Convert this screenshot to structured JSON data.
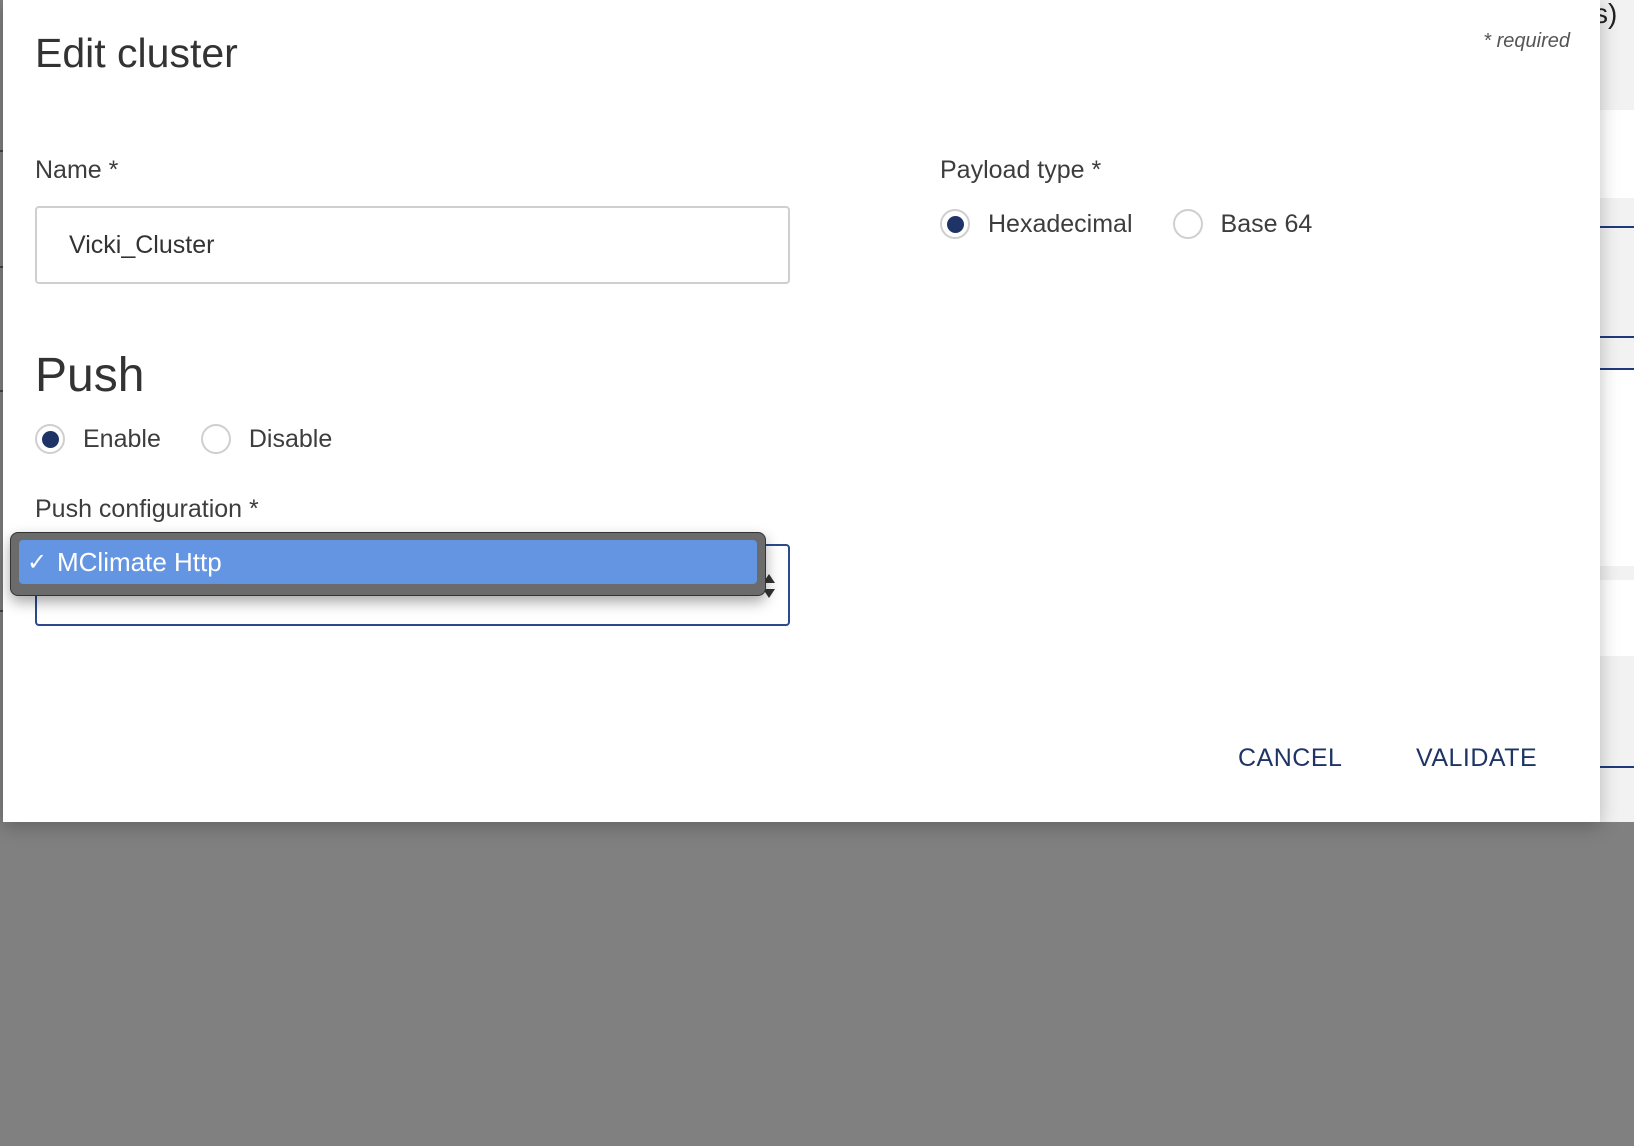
{
  "background": {
    "corner_text": "s)"
  },
  "dialog": {
    "title": "Edit cluster",
    "required_note": "* required",
    "name_field": {
      "label": "Name *",
      "value": "Vicki_Cluster"
    },
    "payload_type": {
      "label": "Payload type *",
      "options": [
        {
          "label": "Hexadecimal",
          "selected": true
        },
        {
          "label": "Base 64",
          "selected": false
        }
      ]
    },
    "push": {
      "title": "Push",
      "options": [
        {
          "label": "Enable",
          "selected": true
        },
        {
          "label": "Disable",
          "selected": false
        }
      ]
    },
    "push_configuration": {
      "label": "Push configuration *",
      "selected": "MClimate Http",
      "options": [
        "MClimate Http"
      ]
    },
    "buttons": {
      "cancel": "CANCEL",
      "validate": "VALIDATE"
    }
  },
  "colors": {
    "overlay": "#808080",
    "accent": "#1f3466",
    "focus_border": "#2c4a8c",
    "dropdown_highlight": "#6495e2"
  }
}
